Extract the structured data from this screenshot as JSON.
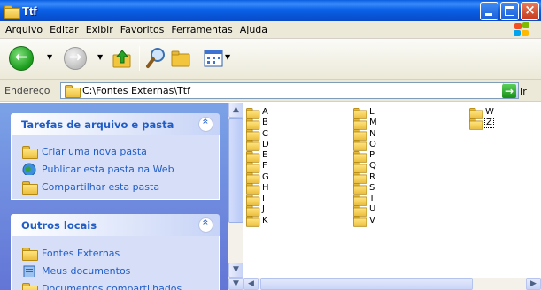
{
  "window": {
    "title": "Ttf"
  },
  "menu": [
    "Arquivo",
    "Editar",
    "Exibir",
    "Favoritos",
    "Ferramentas",
    "Ajuda"
  ],
  "address": {
    "label": "Endereço",
    "value": "C:\\Fontes Externas\\Ttf",
    "go_label": "Ir"
  },
  "tasks_panel": {
    "title": "Tarefas de arquivo e pasta",
    "items": [
      {
        "label": "Criar uma nova pasta",
        "icon": "new-folder-icon"
      },
      {
        "label": "Publicar esta pasta na Web",
        "icon": "web-publish-icon"
      },
      {
        "label": "Compartilhar esta pasta",
        "icon": "share-folder-icon"
      }
    ]
  },
  "places_panel": {
    "title": "Outros locais",
    "items": [
      {
        "label": "Fontes Externas",
        "icon": "folder-icon"
      },
      {
        "label": "Meus documentos",
        "icon": "my-documents-icon"
      },
      {
        "label": "Documentos compartilhados",
        "icon": "shared-documents-icon"
      }
    ]
  },
  "folders": {
    "columns": [
      [
        "A",
        "B",
        "C",
        "D",
        "E",
        "F",
        "G",
        "H",
        "I",
        "J",
        "K"
      ],
      [
        "L",
        "M",
        "N",
        "O",
        "P",
        "Q",
        "R",
        "S",
        "T",
        "U",
        "V"
      ],
      [
        "W",
        "Z"
      ]
    ],
    "selected": "Z"
  },
  "colors": {
    "titlebar": "#0a5fe0",
    "task_link": "#215dc6",
    "pane": "#7ba2e7"
  }
}
